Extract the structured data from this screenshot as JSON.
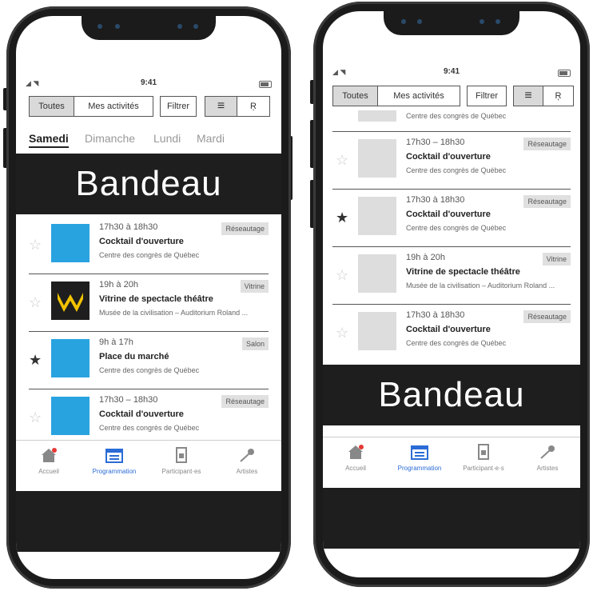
{
  "status": {
    "time": "9:41",
    "signal": "◢ ◥"
  },
  "toolbar": {
    "all": "Toutes",
    "mine": "Mes activités",
    "filter": "Filtrer",
    "list_glyph": "≡",
    "grid_glyph": "Ŗ"
  },
  "days": [
    "Samedi",
    "Dimanche",
    "Lundi",
    "Mardi"
  ],
  "bandeau": "Bandeau",
  "left_events": [
    {
      "time": "17h30 à 18h30",
      "title": "Cocktail d'ouverture",
      "place": "Centre des congrès de Québec",
      "tag": "Réseautage",
      "starred": false,
      "thumb": "blue"
    },
    {
      "time": "19h à 20h",
      "title": "Vitrine de spectacle théâtre",
      "place": "Musée de la civilisation – Auditorium Roland ...",
      "tag": "Vitrine",
      "starred": false,
      "thumb": "yellow"
    },
    {
      "time": "9h à 17h",
      "title": "Place du marché",
      "place": "Centre des congrès de Québec",
      "tag": "Salon",
      "starred": true,
      "thumb": "blue"
    },
    {
      "time": "17h30 – 18h30",
      "title": "Cocktail d'ouverture",
      "place": "Centre des congrès de Québec",
      "tag": "Réseautage",
      "starred": false,
      "thumb": "blue"
    }
  ],
  "right_top_place": "Centre des congrès de Québec",
  "right_events": [
    {
      "time": "17h30 – 18h30",
      "title": "Cocktail d'ouverture",
      "place": "Centre des congrès de Québec",
      "tag": "Réseautage",
      "starred": false
    },
    {
      "time": "17h30 à 18h30",
      "title": "Cocktail d'ouverture",
      "place": "Centre des congrès de Québec",
      "tag": "Réseautage",
      "starred": true
    },
    {
      "time": "19h à 20h",
      "title": "Vitrine de spectacle théâtre",
      "place": "Musée de la civilisation – Auditorium Roland ...",
      "tag": "Vitrine",
      "starred": false
    },
    {
      "time": "17h30 à 18h30",
      "title": "Cocktail d'ouverture",
      "place": "Centre des congrès de Québec",
      "tag": "Réseautage",
      "starred": false
    }
  ],
  "tabs": {
    "left": [
      "Accueil",
      "Programmation",
      "Participant·es",
      "Artistes"
    ],
    "right": [
      "Accueil",
      "Programmation",
      "Participant·e·s",
      "Artistes"
    ]
  },
  "icons": {
    "home": "home-icon",
    "calendar": "calendar-icon",
    "participants": "badge-icon",
    "artists": "microphone-icon",
    "star": "star-icon"
  },
  "colors": {
    "accent": "#2b6cd6",
    "bandeau": "#1e1e1e",
    "tile_blue": "#29a3e0",
    "tile_yellow": "#f2c200"
  }
}
